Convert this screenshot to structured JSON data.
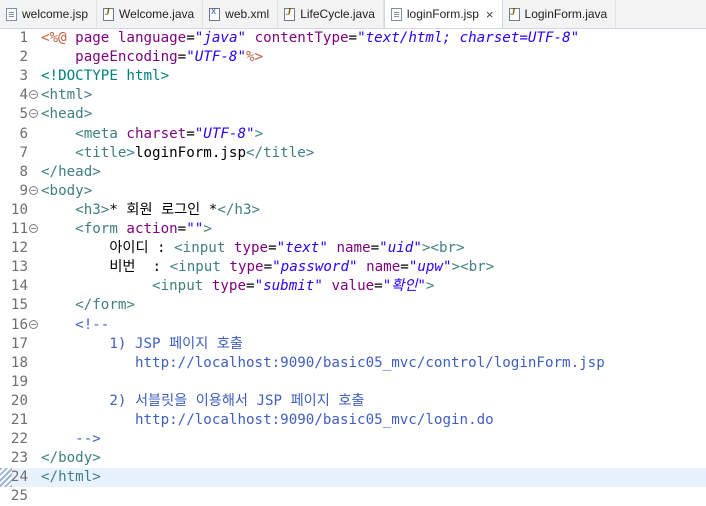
{
  "tabs": [
    {
      "label": "welcome.jsp",
      "icon": "jsp-file-icon"
    },
    {
      "label": "Welcome.java",
      "icon": "java-file-icon"
    },
    {
      "label": "web.xml",
      "icon": "xml-file-icon"
    },
    {
      "label": "LifeCycle.java",
      "icon": "java-file-icon"
    },
    {
      "label": "loginForm.jsp",
      "icon": "jsp-file-icon",
      "active": true,
      "close": "×"
    },
    {
      "label": "LoginForm.java",
      "icon": "java-file-icon"
    }
  ],
  "lines": [
    {
      "n": "1",
      "fold": false,
      "parts": [
        [
          "d",
          "<%@ "
        ],
        [
          "a",
          "page "
        ],
        [
          "a",
          "language"
        ],
        [
          "txt",
          "="
        ],
        [
          "s",
          "\"java\""
        ],
        [
          "txt",
          " "
        ],
        [
          "a",
          "contentType"
        ],
        [
          "txt",
          "="
        ],
        [
          "s",
          "\"text/html; charset=UTF-8\""
        ]
      ]
    },
    {
      "n": "2",
      "fold": false,
      "parts": [
        [
          "txt",
          "    "
        ],
        [
          "a",
          "pageEncoding"
        ],
        [
          "txt",
          "="
        ],
        [
          "s",
          "\"UTF-8\""
        ],
        [
          "d",
          "%>"
        ]
      ]
    },
    {
      "n": "3",
      "fold": false,
      "parts": [
        [
          "dt",
          "<!DOCTYPE html>"
        ]
      ]
    },
    {
      "n": "4",
      "fold": true,
      "parts": [
        [
          "t",
          "<html>"
        ]
      ]
    },
    {
      "n": "5",
      "fold": true,
      "parts": [
        [
          "t",
          "<head>"
        ]
      ]
    },
    {
      "n": "6",
      "fold": false,
      "parts": [
        [
          "txt",
          "    "
        ],
        [
          "t",
          "<meta "
        ],
        [
          "a",
          "charset"
        ],
        [
          "txt",
          "="
        ],
        [
          "s",
          "\"UTF-8\""
        ],
        [
          "t",
          ">"
        ]
      ]
    },
    {
      "n": "7",
      "fold": false,
      "parts": [
        [
          "txt",
          "    "
        ],
        [
          "t",
          "<title>"
        ],
        [
          "txt",
          "loginForm.jsp"
        ],
        [
          "t",
          "</title>"
        ]
      ]
    },
    {
      "n": "8",
      "fold": false,
      "parts": [
        [
          "t",
          "</head>"
        ]
      ]
    },
    {
      "n": "9",
      "fold": true,
      "parts": [
        [
          "t",
          "<body>"
        ]
      ]
    },
    {
      "n": "10",
      "fold": false,
      "parts": [
        [
          "txt",
          "    "
        ],
        [
          "t",
          "<h3>"
        ],
        [
          "txt",
          "* 회원 로그인 *"
        ],
        [
          "t",
          "</h3>"
        ]
      ]
    },
    {
      "n": "11",
      "fold": true,
      "parts": [
        [
          "txt",
          "    "
        ],
        [
          "t",
          "<form "
        ],
        [
          "a",
          "action"
        ],
        [
          "txt",
          "="
        ],
        [
          "s",
          "\"\""
        ],
        [
          "t",
          ">"
        ]
      ]
    },
    {
      "n": "12",
      "fold": false,
      "parts": [
        [
          "txt",
          "        아이디 : "
        ],
        [
          "t",
          "<input "
        ],
        [
          "a",
          "type"
        ],
        [
          "txt",
          "="
        ],
        [
          "s",
          "\"text\""
        ],
        [
          "txt",
          " "
        ],
        [
          "a",
          "name"
        ],
        [
          "txt",
          "="
        ],
        [
          "s",
          "\"uid\""
        ],
        [
          "t",
          "><br>"
        ]
      ]
    },
    {
      "n": "13",
      "fold": false,
      "parts": [
        [
          "txt",
          "        비번  : "
        ],
        [
          "t",
          "<input "
        ],
        [
          "a",
          "type"
        ],
        [
          "txt",
          "="
        ],
        [
          "s",
          "\"password\""
        ],
        [
          "txt",
          " "
        ],
        [
          "a",
          "name"
        ],
        [
          "txt",
          "="
        ],
        [
          "s",
          "\"upw\""
        ],
        [
          "t",
          "><br>"
        ]
      ]
    },
    {
      "n": "14",
      "fold": false,
      "parts": [
        [
          "txt",
          "             "
        ],
        [
          "t",
          "<input "
        ],
        [
          "a",
          "type"
        ],
        [
          "txt",
          "="
        ],
        [
          "s",
          "\"submit\""
        ],
        [
          "txt",
          " "
        ],
        [
          "a",
          "value"
        ],
        [
          "txt",
          "="
        ],
        [
          "s",
          "\"확인\""
        ],
        [
          "t",
          ">"
        ]
      ]
    },
    {
      "n": "15",
      "fold": false,
      "parts": [
        [
          "txt",
          "    "
        ],
        [
          "t",
          "</form>"
        ]
      ]
    },
    {
      "n": "16",
      "fold": true,
      "parts": [
        [
          "txt",
          "    "
        ],
        [
          "c",
          "<!--"
        ]
      ]
    },
    {
      "n": "17",
      "fold": false,
      "parts": [
        [
          "c",
          "        1) JSP 페이지 호출"
        ]
      ]
    },
    {
      "n": "18",
      "fold": false,
      "parts": [
        [
          "c",
          "           http://localhost:9090/basic05_mvc/control/loginForm.jsp"
        ]
      ]
    },
    {
      "n": "19",
      "fold": false,
      "parts": [
        [
          "c",
          ""
        ]
      ]
    },
    {
      "n": "20",
      "fold": false,
      "parts": [
        [
          "c",
          "        2) 서블릿을 이용해서 JSP 페이지 호출"
        ]
      ]
    },
    {
      "n": "21",
      "fold": false,
      "parts": [
        [
          "c",
          "           http://localhost:9090/basic05_mvc/login.do"
        ]
      ]
    },
    {
      "n": "22",
      "fold": false,
      "parts": [
        [
          "c",
          "    -->"
        ]
      ]
    },
    {
      "n": "23",
      "fold": false,
      "parts": [
        [
          "t",
          "</body>"
        ]
      ]
    },
    {
      "n": "24",
      "fold": false,
      "current": true,
      "parts": [
        [
          "t",
          "</html>"
        ]
      ]
    },
    {
      "n": "25",
      "fold": false,
      "parts": []
    }
  ]
}
